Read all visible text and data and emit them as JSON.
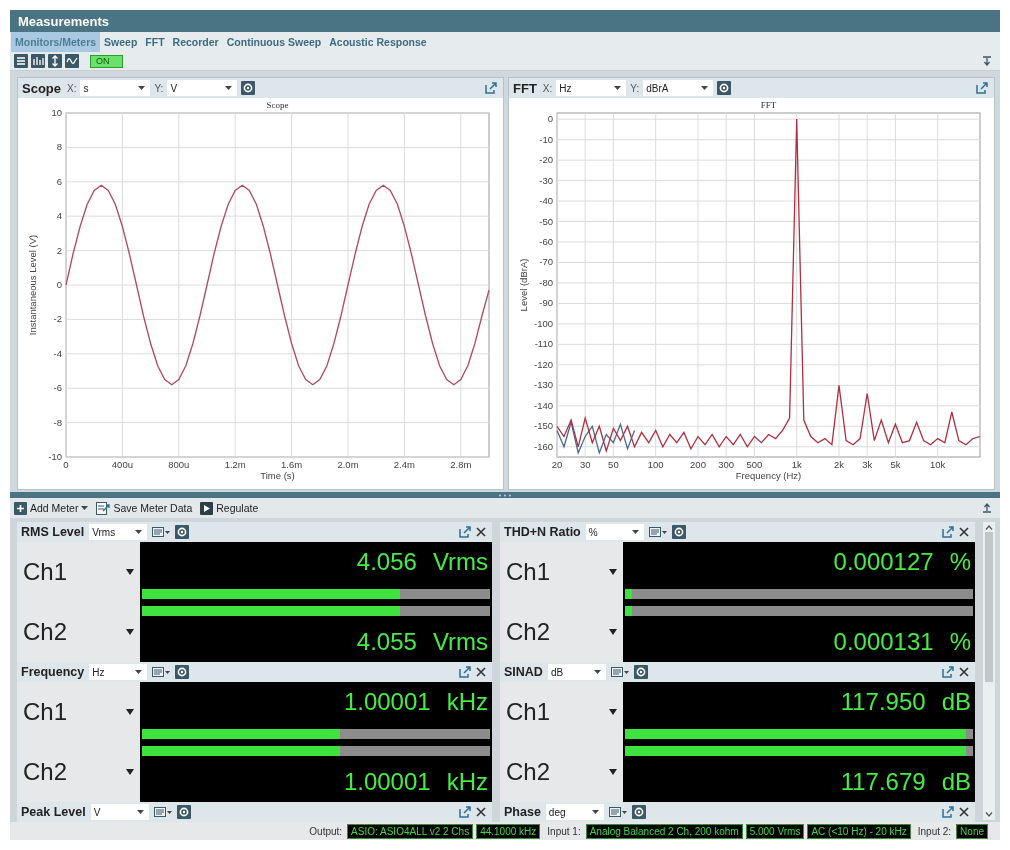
{
  "window": {
    "title": "Measurements"
  },
  "tabs": [
    {
      "label": "Monitors/Meters",
      "selected": true
    },
    {
      "label": "Sweep",
      "selected": false
    },
    {
      "label": "FFT",
      "selected": false
    },
    {
      "label": "Recorder",
      "selected": false
    },
    {
      "label": "Continuous Sweep",
      "selected": false
    },
    {
      "label": "Acoustic Response",
      "selected": false
    }
  ],
  "toolbar": {
    "toggle": {
      "label": "ON",
      "on": true
    }
  },
  "panels": [
    {
      "title": "Scope",
      "x_label": "X:",
      "x_unit": "s",
      "y_label": "Y:",
      "y_unit": "V",
      "chart_data": {
        "type": "line",
        "title": "Scope",
        "xlabel": "Time (s)",
        "ylabel": "Instantaneous Level (V)",
        "categories": [
          "0",
          null,
          null,
          null,
          null,
          null,
          null,
          null,
          "400u",
          null,
          null,
          null,
          null,
          null,
          null,
          null,
          "800u",
          null,
          null,
          null,
          null,
          null,
          null,
          null,
          "1.2m",
          null,
          null,
          null,
          null,
          null,
          null,
          null,
          "1.6m",
          null,
          null,
          null,
          null,
          null,
          null,
          null,
          "2.0m",
          null,
          null,
          null,
          null,
          null,
          null,
          null,
          "2.4m",
          null,
          null,
          null,
          null,
          null,
          null,
          null,
          "2.8m",
          null,
          null,
          null,
          null
        ],
        "series": [
          {
            "color": "#b04a5a",
            "values": [
              0,
              1.8,
              3.4,
              4.7,
              5.5,
              5.8,
              5.5,
              4.7,
              3.4,
              1.8,
              0,
              -1.8,
              -3.4,
              -4.7,
              -5.5,
              -5.8,
              -5.5,
              -4.7,
              -3.4,
              -1.8,
              0,
              1.8,
              3.4,
              4.7,
              5.5,
              5.8,
              5.5,
              4.7,
              3.4,
              1.8,
              0,
              -1.8,
              -3.4,
              -4.7,
              -5.5,
              -5.8,
              -5.5,
              -4.7,
              -3.4,
              -1.8,
              0,
              1.8,
              3.4,
              4.7,
              5.5,
              5.8,
              5.5,
              4.7,
              3.4,
              1.8,
              0,
              -1.8,
              -3.4,
              -4.7,
              -5.5,
              -5.8,
              -5.5,
              -4.7,
              -3.4,
              -1.8,
              -0.3
            ]
          }
        ],
        "ylim": [
          -10,
          10
        ],
        "grid": true,
        "yticks": [
          -10,
          -8,
          -6,
          -4,
          -2,
          0,
          2,
          4,
          6,
          8,
          10
        ]
      }
    },
    {
      "title": "FFT",
      "x_label": "X:",
      "x_unit": "Hz",
      "y_label": "Y:",
      "y_unit": "dBrA",
      "chart_data": {
        "type": "line",
        "title": "FFT",
        "xlabel": "Frequency (Hz)",
        "ylabel": "Level (dBrA)",
        "categories": [
          "20",
          null,
          null,
          null,
          "30",
          null,
          null,
          null,
          "50",
          null,
          null,
          null,
          null,
          null,
          "100",
          null,
          null,
          null,
          null,
          null,
          "200",
          null,
          null,
          null,
          "300",
          null,
          null,
          null,
          "500",
          null,
          null,
          null,
          null,
          null,
          "1k",
          null,
          null,
          null,
          null,
          null,
          "2k",
          null,
          null,
          null,
          "3k",
          null,
          null,
          null,
          "5k",
          null,
          null,
          null,
          null,
          null,
          "10k",
          null,
          null,
          null,
          null,
          null,
          null
        ],
        "series": [
          {
            "color": "#4a6a90",
            "values": [
              -152,
              -160,
              -148,
              -163,
              -155,
              -150,
              -163,
              -154,
              -158,
              -149,
              -161,
              -152,
              null,
              null,
              null,
              null,
              null,
              null,
              null,
              null,
              null,
              null,
              null,
              null,
              null,
              null,
              null,
              null,
              null,
              null,
              null,
              null,
              null,
              null,
              null,
              null,
              null,
              null,
              null,
              null,
              null,
              null,
              null,
              null,
              null,
              null,
              null,
              null,
              null,
              null,
              null,
              null,
              null,
              null,
              null,
              null,
              null,
              null,
              null,
              null,
              null
            ]
          },
          {
            "color": "#b03040",
            "values": [
              -150,
              -155,
              -147,
              -160,
              -146,
              -158,
              -150,
              -162,
              -151,
              -157,
              -150,
              -160,
              -153,
              -158,
              -152,
              -160,
              -154,
              -158,
              -153,
              -161,
              -155,
              -159,
              -154,
              -160,
              -155,
              -159,
              -154,
              -160,
              -155,
              -158,
              -154,
              -156,
              -152,
              -146,
              0,
              -147,
              -155,
              -158,
              -156,
              -159,
              -130,
              -157,
              -159,
              -156,
              -134,
              -157,
              -147,
              -158,
              -149,
              -158,
              -157,
              -148,
              -157,
              -159,
              -156,
              -158,
              -143,
              -157,
              -159,
              -156,
              -155
            ]
          }
        ],
        "ylim": [
          -165,
          3
        ],
        "grid": true,
        "yticks": [
          0,
          -10,
          -20,
          -30,
          -40,
          -50,
          -60,
          -70,
          -80,
          -90,
          -100,
          -110,
          -120,
          -130,
          -140,
          -150,
          -160
        ]
      }
    }
  ],
  "meter_toolbar": [
    {
      "kind": "dropdown",
      "label": "Add Meter"
    },
    {
      "kind": "button",
      "label": "Save Meter Data"
    },
    {
      "kind": "play",
      "label": "Regulate"
    }
  ],
  "meters": [
    {
      "title": "RMS Level",
      "unit": "Vrms",
      "channels": [
        {
          "label": "Ch1",
          "value": "4.056",
          "unit": "Vrms",
          "level": 0.74
        },
        {
          "label": "Ch2",
          "value": "4.055",
          "unit": "Vrms",
          "level": 0.74
        }
      ]
    },
    {
      "title": "THD+N Ratio",
      "unit": "%",
      "channels": [
        {
          "label": "Ch1",
          "value": "0.000127",
          "unit": "%",
          "level": 0.02
        },
        {
          "label": "Ch2",
          "value": "0.000131",
          "unit": "%",
          "level": 0.02
        }
      ]
    },
    {
      "title": "Frequency",
      "unit": "Hz",
      "channels": [
        {
          "label": "Ch1",
          "value": "1.00001",
          "unit": "kHz",
          "level": 0.57
        },
        {
          "label": "Ch2",
          "value": "1.00001",
          "unit": "kHz",
          "level": 0.57
        }
      ]
    },
    {
      "title": "SINAD",
      "unit": "dB",
      "channels": [
        {
          "label": "Ch1",
          "value": "117.950",
          "unit": "dB",
          "level": 0.98
        },
        {
          "label": "Ch2",
          "value": "117.679",
          "unit": "dB",
          "level": 0.98
        }
      ]
    },
    {
      "title": "Peak Level",
      "unit": "V"
    },
    {
      "title": "Phase",
      "unit": "deg"
    }
  ],
  "status_bar": [
    {
      "kind": "label",
      "text": "Output:"
    },
    {
      "kind": "value",
      "text": "ASIO: ASIO4ALL v2 2 Chs"
    },
    {
      "kind": "value",
      "text": "44.1000 kHz"
    },
    {
      "kind": "label",
      "text": "Input 1:"
    },
    {
      "kind": "value",
      "text": "Analog Balanced 2 Ch, 200 kohm"
    },
    {
      "kind": "value",
      "text": "5.000 Vrms"
    },
    {
      "kind": "value",
      "text": "AC (<10 Hz) - 20 kHz"
    },
    {
      "kind": "label",
      "text": "Input 2:"
    },
    {
      "kind": "value",
      "text": "None"
    }
  ]
}
